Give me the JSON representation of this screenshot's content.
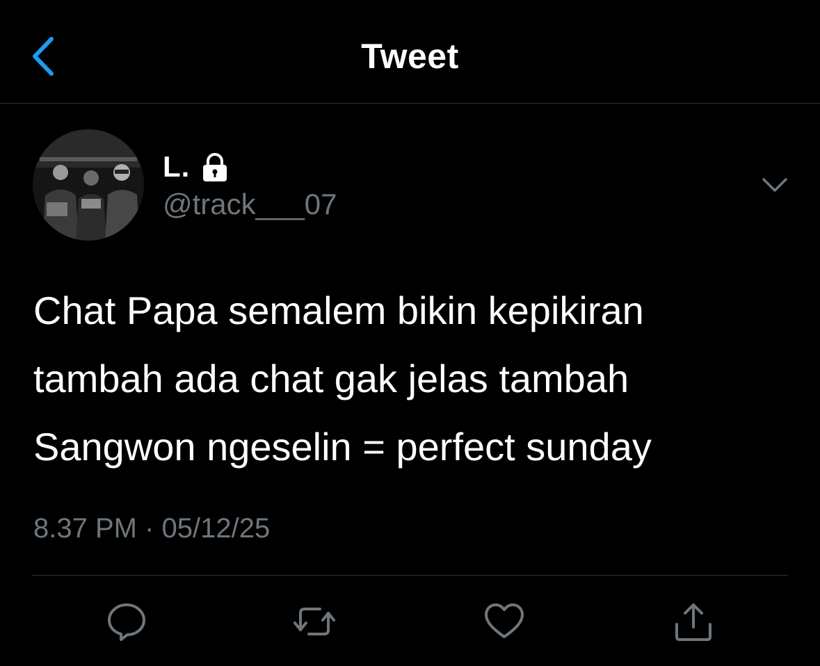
{
  "colors": {
    "background": "#000000",
    "accent": "#1d9bf0",
    "primary_text": "#ffffff",
    "secondary_text": "#6e767d",
    "divider": "#2f3336"
  },
  "header": {
    "back_icon": "chevron-left-icon",
    "title": "Tweet"
  },
  "author": {
    "display_name": "L.",
    "protected_icon": "lock-icon",
    "handle": "@track___07",
    "avatar": "avatar-photo"
  },
  "menu": {
    "icon": "chevron-down-icon"
  },
  "tweet": {
    "lines": [
      "Chat Papa semalem bikin kepikiran",
      "tambah ada chat gak jelas tambah",
      "Sangwon ngeselin = perfect sunday"
    ],
    "time": "8.37 PM",
    "separator": "·",
    "date": "05/12/25"
  },
  "actions": [
    {
      "icon": "reply-icon"
    },
    {
      "icon": "retweet-icon"
    },
    {
      "icon": "like-icon"
    },
    {
      "icon": "share-icon"
    }
  ]
}
